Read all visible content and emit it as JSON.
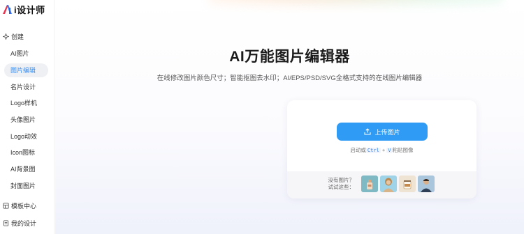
{
  "brand": {
    "logo_glyph": "A",
    "name": "i设计师"
  },
  "sidebar": {
    "create_section": "创建",
    "items": [
      {
        "label": "AI图片"
      },
      {
        "label": "图片编辑"
      },
      {
        "label": "名片设计"
      },
      {
        "label": "Logo样机"
      },
      {
        "label": "头像图片"
      },
      {
        "label": "Logo动效"
      },
      {
        "label": "Icon图标"
      },
      {
        "label": "AI背景图"
      },
      {
        "label": "封面图片"
      }
    ],
    "active_index": 1,
    "template_center": "模板中心",
    "my_designs": "我的设计"
  },
  "main": {
    "title": "AI万能图片编辑器",
    "subtitle": "在线修改图片颜色尺寸；智能抠图去水印；AI/EPS/PSD/SVG全格式支持的在线图片编辑器",
    "upload_button": "上传图片",
    "paste_hint": {
      "prefix": "启动或",
      "key1": "Ctrl",
      "plus": " + ",
      "key2": "V",
      "suffix": "粘贴图像"
    },
    "samples": {
      "label_line1": "没有图片？",
      "label_line2": "试试这些："
    }
  },
  "colors": {
    "accent": "#2f9bf5",
    "active_text": "#3b8ff0",
    "active_bg": "#eef0f4"
  },
  "icons": [
    "create-icon",
    "upload-icon",
    "template-icon",
    "my-design-icon"
  ]
}
